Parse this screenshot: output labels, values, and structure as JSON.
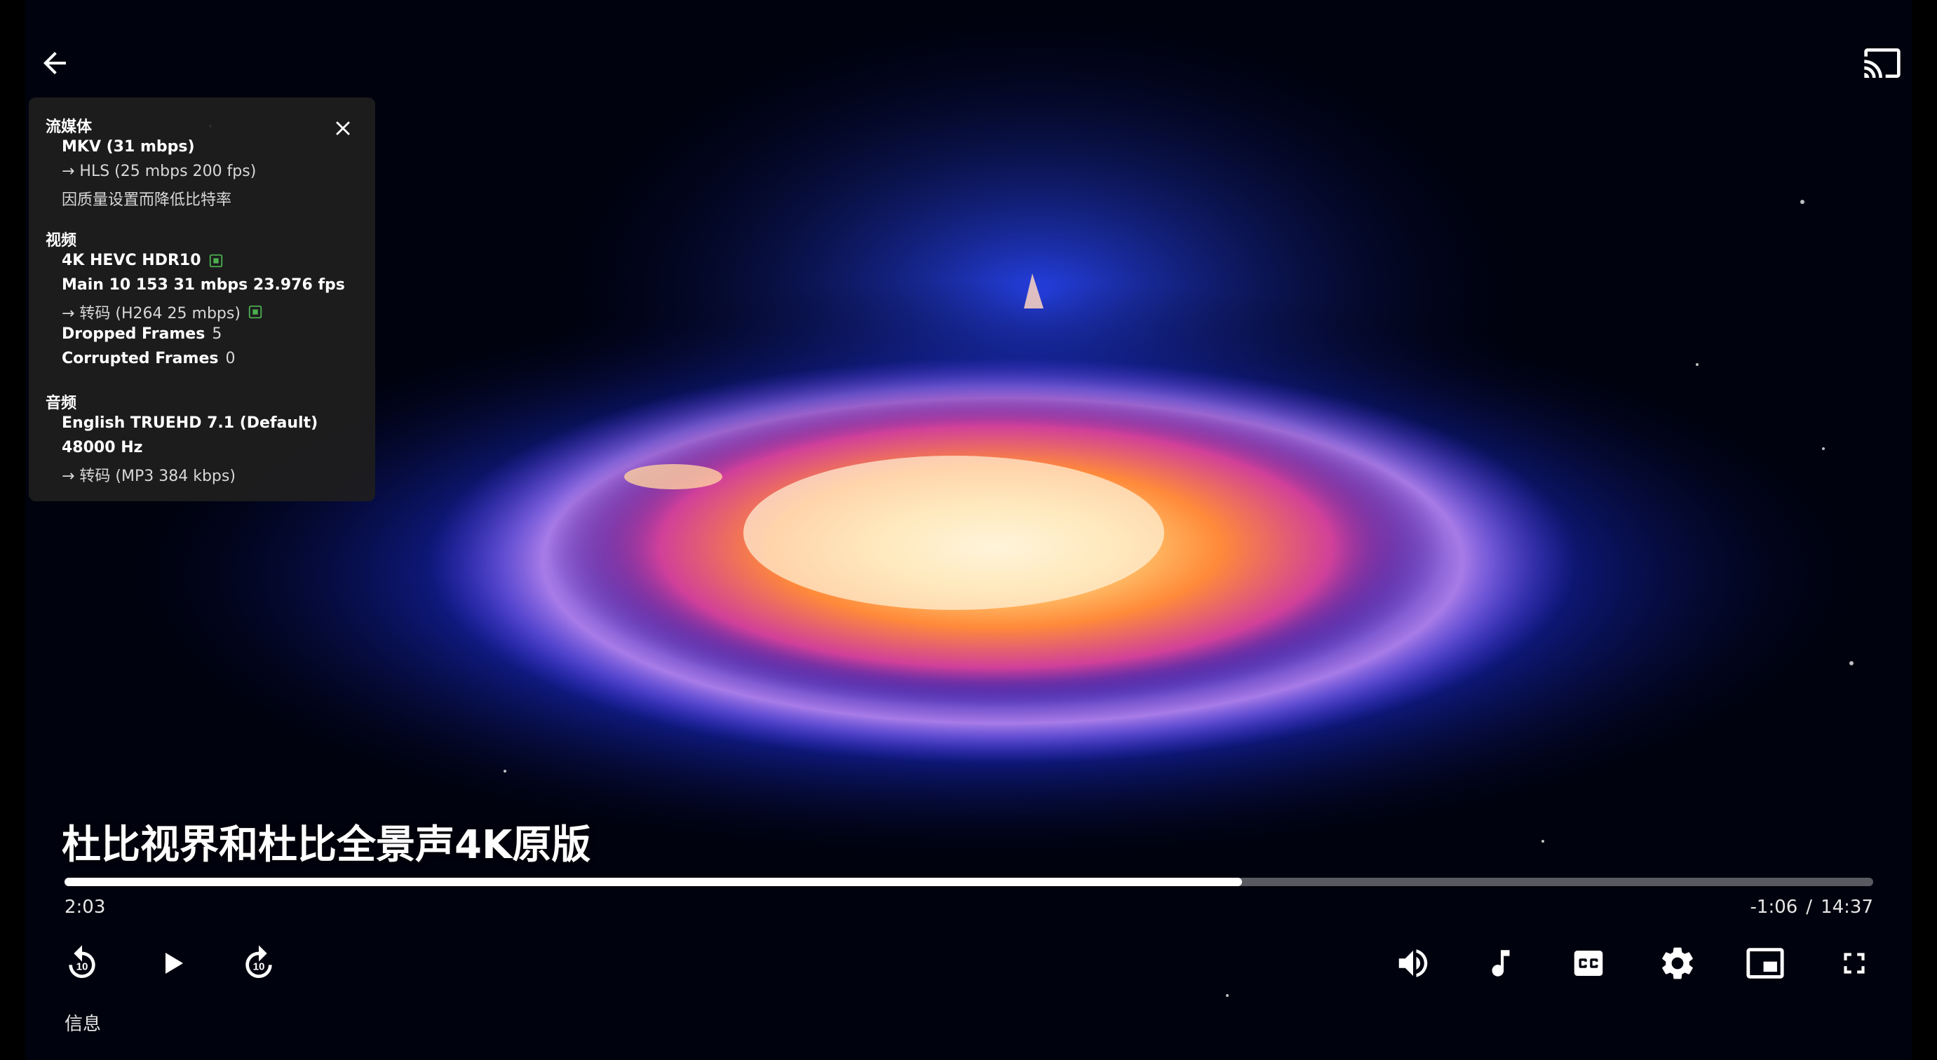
{
  "player": {
    "title": "杜比视界和杜比全景声4K原版",
    "progress_fraction": 0.651,
    "time_current": "2:03",
    "time_remaining": "-1:06",
    "time_separator": "/",
    "time_total": "14:37",
    "info_tab_label": "信息"
  },
  "info_panel": {
    "streaming": {
      "title": "流媒体",
      "container": "MKV (31 mbps)",
      "target": "→ HLS (25 mbps 200 fps)",
      "reason": "因质量设置而降低比特率"
    },
    "video": {
      "title": "视频",
      "codec": "4K HEVC HDR10",
      "profile": "Main 10 153 31 mbps 23.976 fps",
      "transcode": "→ 转码 (H264 25 mbps)",
      "dropped_label": "Dropped Frames",
      "dropped_value": "5",
      "corrupted_label": "Corrupted Frames",
      "corrupted_value": "0"
    },
    "audio": {
      "title": "音频",
      "track": "English TRUEHD 7.1 (Default)",
      "sample_rate": "48000 Hz",
      "transcode": "→ 转码 (MP3 384 kbps)"
    }
  },
  "icons": {
    "back": "arrow-left",
    "cast": "cast",
    "close": "close-x",
    "hardware": "chip",
    "replay10": "replay-10",
    "play": "play",
    "forward10": "forward-10",
    "volume": "volume-up",
    "audio_track": "music-note",
    "subtitles": "closed-captions",
    "settings": "gear",
    "pip": "picture-in-picture",
    "fullscreen": "fullscreen"
  },
  "colors": {
    "hardware_badge": "#4caf50",
    "panel_bg": "#1e1e1e"
  }
}
